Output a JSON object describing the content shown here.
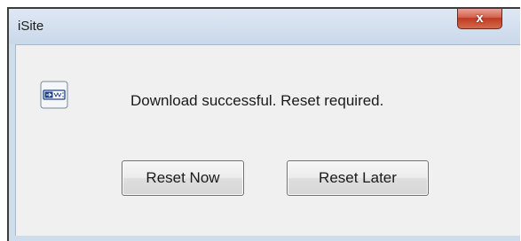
{
  "window": {
    "title": "iSite"
  },
  "titlebar": {
    "close_glyph": "x"
  },
  "dialog": {
    "icon": "download-device-icon",
    "message": "Download successful. Reset required.",
    "buttons": [
      {
        "label": "Reset Now"
      },
      {
        "label": "Reset Later"
      }
    ]
  },
  "colors": {
    "frame": "#cfdcec",
    "client": "#f0f0f0",
    "close_button": "#c7432c"
  }
}
